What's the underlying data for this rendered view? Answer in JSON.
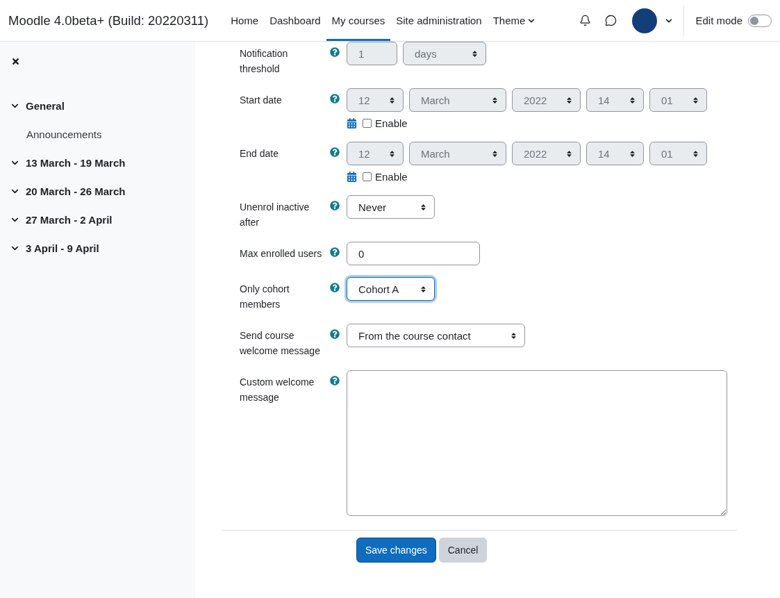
{
  "header": {
    "site_name": "Moodle 4.0beta+ (Build: 20220311)",
    "nav": [
      {
        "label": "Home",
        "selected": false,
        "kind": "link"
      },
      {
        "label": "Dashboard",
        "selected": false,
        "kind": "link"
      },
      {
        "label": "My courses",
        "selected": true,
        "kind": "link"
      },
      {
        "label": "Site administration",
        "selected": false,
        "kind": "link"
      },
      {
        "label": "Theme",
        "selected": false,
        "kind": "menu"
      }
    ],
    "edit_mode": {
      "label": "Edit mode",
      "on": false
    }
  },
  "sidebar": {
    "sections": [
      {
        "title": "General",
        "expanded": true,
        "children": [
          {
            "title": "Announcements"
          }
        ]
      },
      {
        "title": "13 March - 19 March",
        "expanded": true
      },
      {
        "title": "20 March - 26 March",
        "expanded": true
      },
      {
        "title": "27 March - 2 April",
        "expanded": true
      },
      {
        "title": "3 April - 9 April",
        "expanded": true
      }
    ]
  },
  "form": {
    "rows": [
      {
        "kind": "duration",
        "label": "Notification threshold",
        "value": "1",
        "unit": "days",
        "disabled": true
      },
      {
        "kind": "date",
        "label": "Start date",
        "parts": [
          "12",
          "March",
          "2022",
          "14",
          "01"
        ],
        "disabled": true,
        "enable": {
          "label": "Enable",
          "checked": false
        }
      },
      {
        "kind": "date",
        "label": "End date",
        "parts": [
          "12",
          "March",
          "2022",
          "14",
          "01"
        ],
        "disabled": true,
        "enable": {
          "label": "Enable",
          "checked": false
        }
      },
      {
        "kind": "select",
        "label": "Unenrol inactive after",
        "value": "Never",
        "focused": false
      },
      {
        "kind": "text",
        "label": "Max enrolled users",
        "value": "0"
      },
      {
        "kind": "select",
        "label": "Only cohort members",
        "value": "Cohort A",
        "focused": true
      },
      {
        "kind": "select",
        "label": "Send course welcome message",
        "value": "From the course contact",
        "focused": false
      },
      {
        "kind": "textarea",
        "label": "Custom welcome message"
      }
    ]
  },
  "buttons": [
    {
      "label": "Save changes",
      "kind": "primary"
    },
    {
      "label": "Cancel",
      "kind": "secondary"
    }
  ]
}
